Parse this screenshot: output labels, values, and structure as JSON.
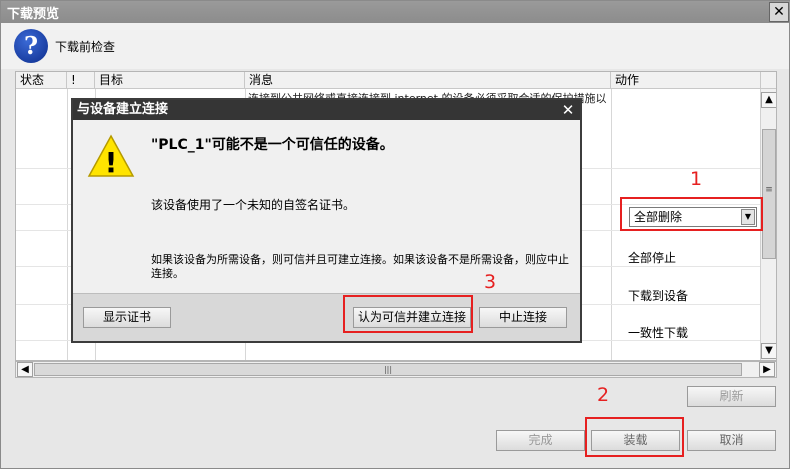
{
  "window": {
    "title": "下载预览",
    "close_glyph": "✕"
  },
  "header": {
    "icon_glyph": "?",
    "label": "下载前检查"
  },
  "table": {
    "columns": [
      "状态",
      "!",
      "目标",
      "消息",
      "动作"
    ],
    "message_partial": "连接到公共网络或直接连接到 internet 的设备必须采取合适的保护措施以防止未经授权的访问。例如，使用防火墙或有",
    "actions": [
      "全部停止",
      "下载到设备",
      "一致性下载"
    ],
    "select_value": "全部删除",
    "scroll_up": "▲",
    "scroll_down": "▼",
    "scroll_left": "◀",
    "scroll_right": "▶",
    "vgrip": "≡",
    "hgrip": "|||"
  },
  "buttons": {
    "refresh": "刷新",
    "finish": "完成",
    "load": "装载",
    "cancel": "取消"
  },
  "dialog": {
    "title": "与设备建立连接",
    "close_glyph": "✕",
    "heading": "\"PLC_1\"可能不是一个可信任的设备。",
    "line1": "该设备使用了一个未知的自签名证书。",
    "line2": "如果该设备为所需设备，则可信并且可建立连接。如果该设备不是所需设备，则应中止连接。",
    "warn_glyph": "!",
    "btn_show_cert": "显示证书",
    "btn_trust": "认为可信并建立连接",
    "btn_abort": "中止连接"
  },
  "annotations": {
    "n1": "1",
    "n2": "2",
    "n3": "3",
    "color": "#e62020"
  }
}
